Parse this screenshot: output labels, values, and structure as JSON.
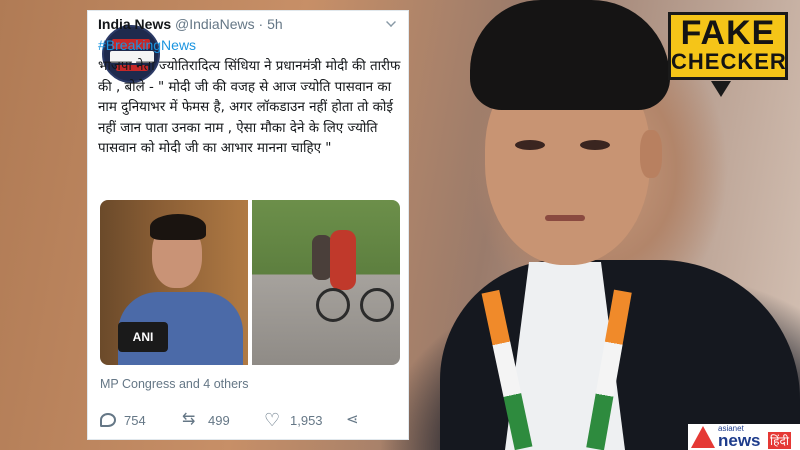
{
  "tweet": {
    "author_name": "India News",
    "handle": "@IndiaNews",
    "separator": "·",
    "time": "5h",
    "hashtag": "#BreakingNews",
    "text": "भाजपा नेता ज्योतिरादित्य सिंधिया ने प्रधानमंत्री मोदी की तारीफ की , बोले - \" मोदी जी की वजह से आज ज्योति पासवान का नाम दुनियाभर में फेमस है, अगर लॉकडाउन नहीं होता तो कोई नहीं जान पाता उनका नाम , ऐसा मौका देने के लिए ज्योति पासवान को मोदी जी का आभार मानना चाहिए \"",
    "image1_mic_label": "ANI",
    "footer_note": "MP Congress and 4 others",
    "actions": {
      "reply_count": "754",
      "retweet_count": "499",
      "like_count": "1,953"
    }
  },
  "badge": {
    "line1": "FAKE",
    "line2": "CHECKER"
  },
  "network_logo": {
    "small": "asianet",
    "big": "news",
    "lang": "हिंदी"
  },
  "colors": {
    "link": "#1b95e0",
    "badge_bg": "#f5c518",
    "logo_red": "#e53935",
    "logo_blue": "#1e3c8c"
  }
}
